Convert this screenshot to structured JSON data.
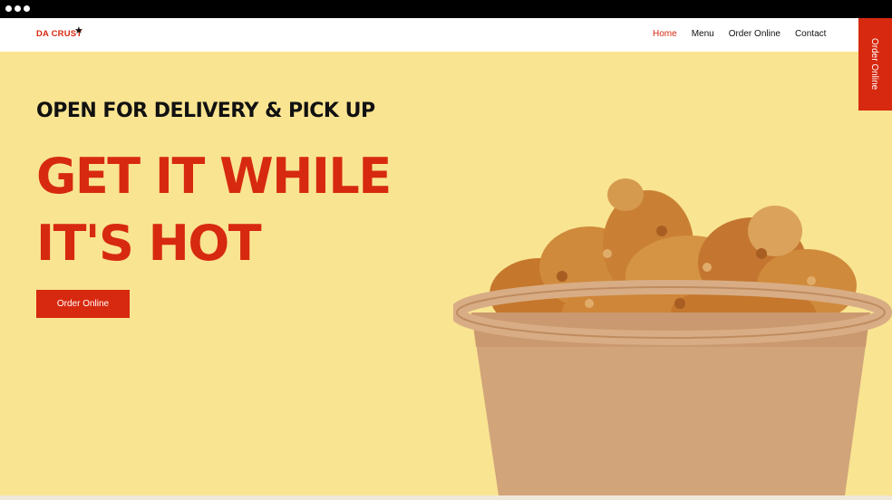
{
  "brand": {
    "name": "DA CRUST",
    "star": "★"
  },
  "nav": {
    "items": [
      {
        "label": "Home",
        "active": true
      },
      {
        "label": "Menu",
        "active": false
      },
      {
        "label": "Order Online",
        "active": false
      },
      {
        "label": "Contact",
        "active": false
      }
    ]
  },
  "side_tab": {
    "label": "Order Online"
  },
  "hero": {
    "eyebrow": "OPEN FOR DELIVERY & PICK UP",
    "headline_line1": "GET IT WHILE",
    "headline_line2": "IT'S HOT",
    "cta_label": "Order Online",
    "image_subject": "fried-chicken-bucket"
  },
  "colors": {
    "accent": "#d7290f",
    "background": "#f9e491",
    "text": "#111111"
  }
}
